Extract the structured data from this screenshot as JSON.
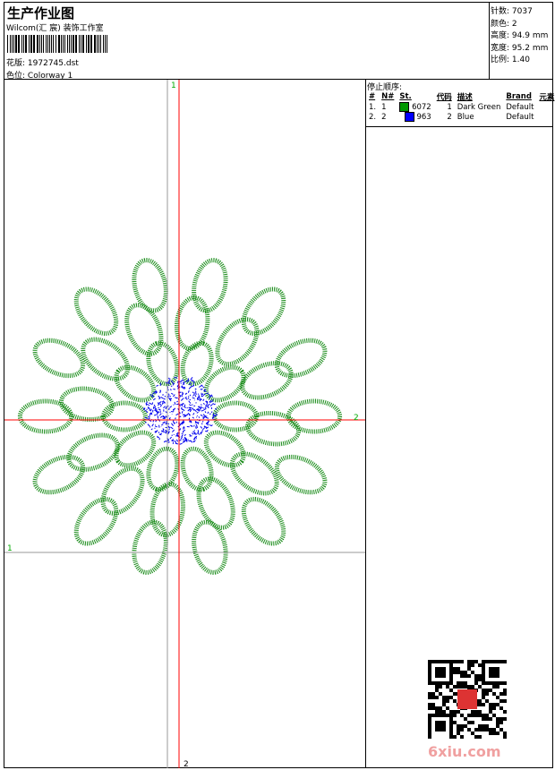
{
  "header": {
    "title": "生产作业图",
    "company": "Wilcom(汇 宸) 装饰工作室",
    "design_label": "花版:",
    "design_value": "1972745.dst",
    "colorway_label": "色位:",
    "colorway_value": "Colorway 1"
  },
  "stats": [
    {
      "label": "针数:",
      "value": "7037"
    },
    {
      "label": "颜色:",
      "value": "2"
    },
    {
      "label": "高度:",
      "value": "94.9 mm"
    },
    {
      "label": "宽度:",
      "value": "95.2 mm"
    },
    {
      "label": "比例:",
      "value": "1.40"
    }
  ],
  "stop_sequence": {
    "title": "停止顺序:",
    "headers": [
      "#",
      "N#",
      "St.",
      "代码",
      "描述",
      "Brand",
      "元素"
    ],
    "rows": [
      {
        "idx": "1.",
        "n": "1",
        "color": "#009900",
        "st": "6072",
        "code": "1",
        "desc": "Dark Green",
        "brand": "Default"
      },
      {
        "idx": "2.",
        "n": "2",
        "color": "#0000ff",
        "st": "963",
        "code": "2",
        "desc": "Blue",
        "brand": "Default"
      }
    ]
  },
  "axes": {
    "top": "1",
    "right": "2",
    "left": "1",
    "bottom": "2"
  },
  "watermark": "6xiu.com"
}
